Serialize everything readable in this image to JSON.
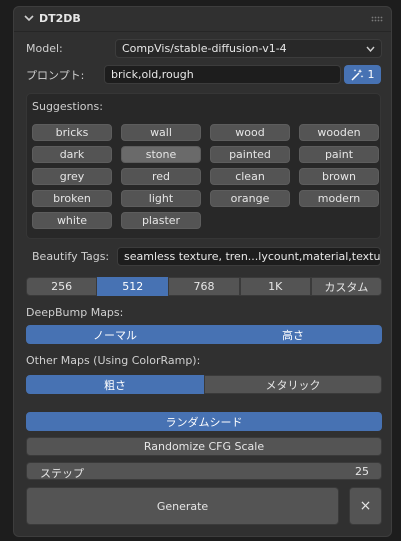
{
  "panel": {
    "title": "DT2DB"
  },
  "model": {
    "label": "Model:",
    "value": "CompVis/stable-diffusion-v1-4"
  },
  "prompt": {
    "label": "プロンプト:",
    "value": "brick,old,rough",
    "magic_count": "1"
  },
  "suggestions": {
    "label": "Suggestions:",
    "items": [
      "bricks",
      "wall",
      "wood",
      "wooden",
      "dark",
      "stone",
      "painted",
      "paint",
      "grey",
      "red",
      "clean",
      "brown",
      "broken",
      "light",
      "orange",
      "modern",
      "white",
      "plaster"
    ],
    "active": "stone"
  },
  "beautify": {
    "label": "Beautify Tags:",
    "value": "seamless texture, tren...lycount,material,texture"
  },
  "resolution": {
    "options": [
      "256",
      "512",
      "768",
      "1K",
      "カスタム"
    ],
    "selected": "512"
  },
  "deepbump": {
    "label": "DeepBump Maps:",
    "options": [
      "ノーマル",
      "高さ"
    ]
  },
  "other_maps": {
    "label": "Other Maps (Using ColorRamp):",
    "options": [
      "粗さ",
      "メタリック"
    ]
  },
  "random_seed": {
    "label": "ランダムシード"
  },
  "randomize_cfg": {
    "label": "Randomize CFG Scale"
  },
  "steps": {
    "label": "ステップ",
    "value": "25"
  },
  "generate": {
    "label": "Generate"
  },
  "close": {
    "label": "×"
  },
  "colors": {
    "accent": "#4772b3",
    "panel": "#303030",
    "background": "#1d1d1d"
  }
}
